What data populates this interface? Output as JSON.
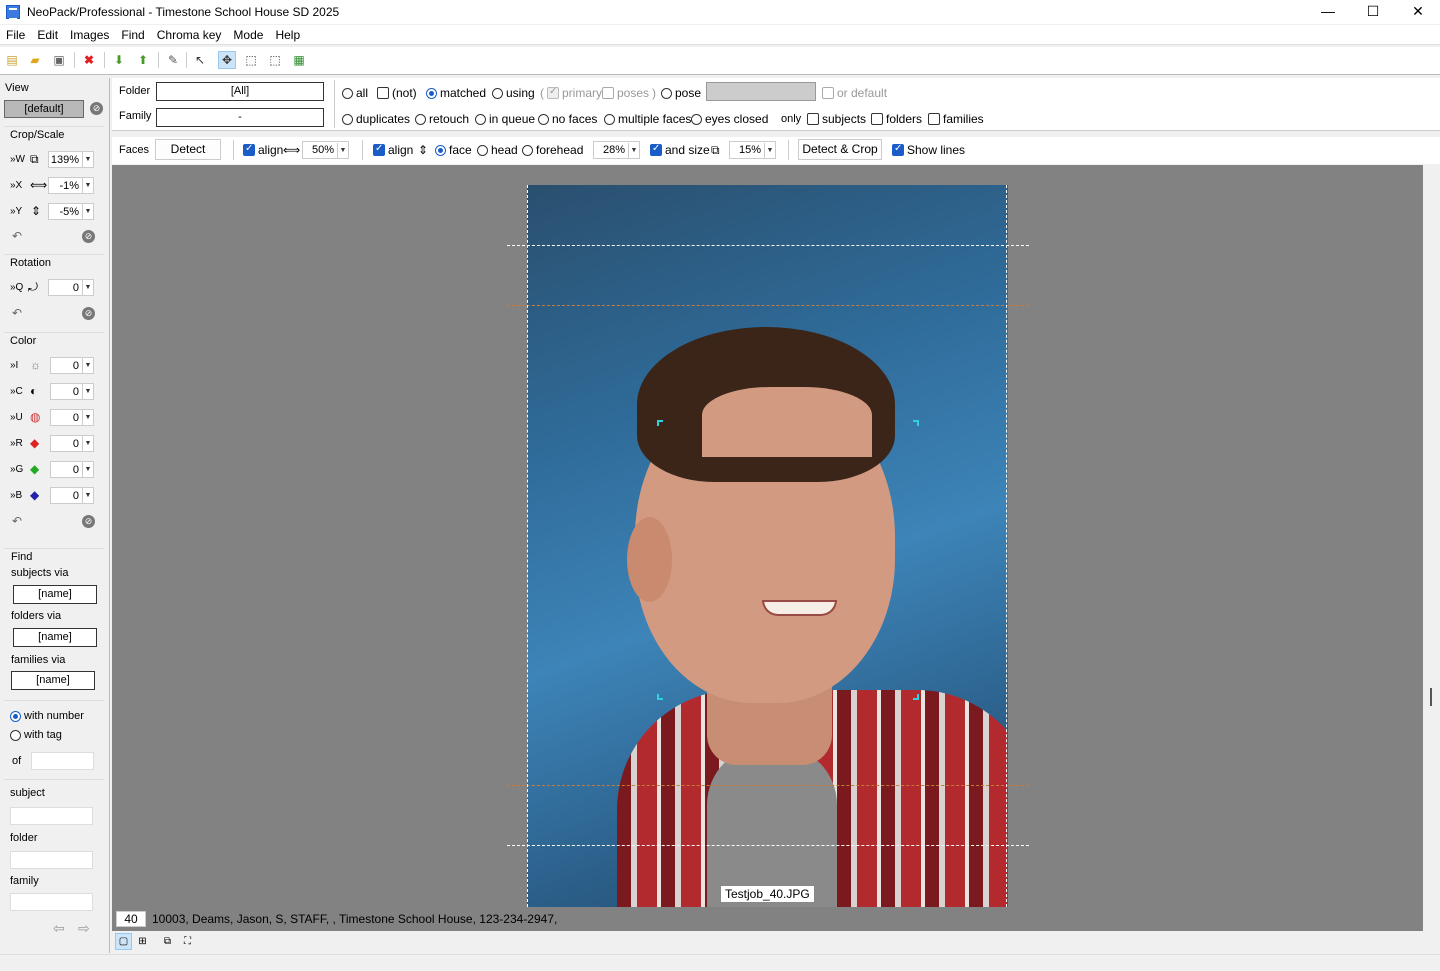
{
  "window": {
    "title": "NeoPack/Professional - Timestone School House SD 2025",
    "minimize": "—",
    "maximize": "☐",
    "close": "✕"
  },
  "menu": [
    "File",
    "Edit",
    "Images",
    "Find",
    "Chroma key",
    "Mode",
    "Help"
  ],
  "left": {
    "view_label": "View",
    "view_value": "[default]",
    "crop_label": "Crop/Scale",
    "crop_rows": [
      {
        "key": "»W",
        "value": "139%"
      },
      {
        "key": "»X",
        "value": "-1%"
      },
      {
        "key": "»Y",
        "value": "-5%"
      }
    ],
    "rotation_label": "Rotation",
    "rotation_row": {
      "key": "»Q",
      "value": "0"
    },
    "color_label": "Color",
    "color_rows": [
      {
        "key": "»I",
        "value": "0"
      },
      {
        "key": "»C",
        "value": "0"
      },
      {
        "key": "»U",
        "value": "0"
      },
      {
        "key": "»R",
        "value": "0"
      },
      {
        "key": "»G",
        "value": "0"
      },
      {
        "key": "»B",
        "value": "0"
      }
    ],
    "find_label": "Find",
    "subjects_via": "subjects via",
    "folders_via": "folders via",
    "families_via": "families via",
    "name_placeholder": "[name]",
    "with_number": "with number",
    "with_tag": "with tag",
    "of": "of",
    "subject": "subject",
    "folder": "folder",
    "family": "family"
  },
  "filter": {
    "folder_label": "Folder",
    "folder_value": "[All]",
    "family_label": "Family",
    "family_value": "-",
    "row1": {
      "all": "all",
      "not": "(not)",
      "matched": "matched",
      "using": "using",
      "primary": "primary",
      "poses": "poses",
      "pose": "pose",
      "or_default": "or default"
    },
    "row2": {
      "duplicates": "duplicates",
      "retouch": "retouch",
      "in_queue": "in queue",
      "no_faces": "no faces",
      "multiple_faces": "multiple faces",
      "eyes_closed": "eyes closed",
      "only": "only",
      "subjects": "subjects",
      "folders": "folders",
      "families": "families"
    }
  },
  "faces": {
    "label": "Faces",
    "detect": "Detect",
    "align1": "align",
    "align1_value": "50%",
    "align2": "align",
    "face": "face",
    "head": "head",
    "forehead": "forehead",
    "pct": "28%",
    "and_size": "and size",
    "size_value": "15%",
    "detect_crop": "Detect & Crop",
    "show_lines": "Show lines"
  },
  "image": {
    "filename": "Testjob_40.JPG"
  },
  "status": {
    "record": "40",
    "text": "10003, Deams, Jason, S, STAFF, , Timestone School House, 123-234-2947,"
  }
}
